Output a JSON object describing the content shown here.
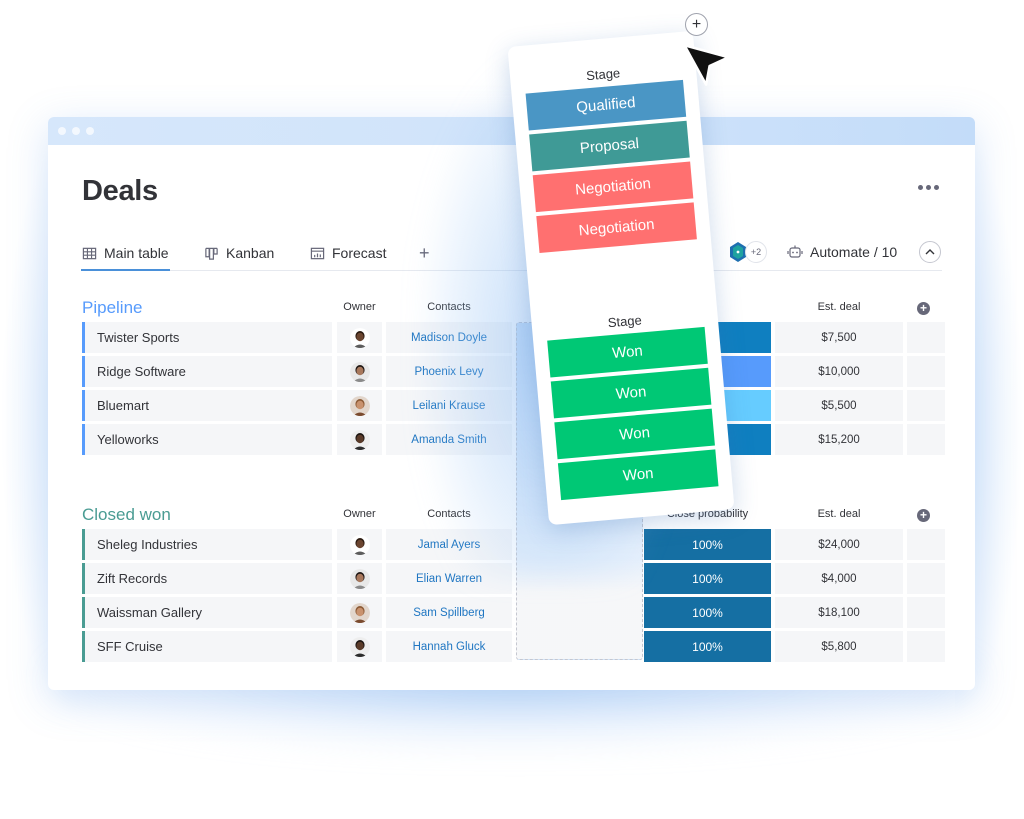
{
  "window": {
    "title": "Deals",
    "more_menu": "more-options"
  },
  "tabs": [
    {
      "label": "Main table",
      "icon": "table-icon",
      "active": true
    },
    {
      "label": "Kanban",
      "icon": "kanban-icon",
      "active": false
    },
    {
      "label": "Forecast",
      "icon": "forecast-icon",
      "active": false
    }
  ],
  "tab_add": "+",
  "toolbar": {
    "members_extra": "+2",
    "automate_label": "Automate / 10"
  },
  "colors": {
    "pipeline": "#579bfc",
    "closed_won": "#4a9c93",
    "qualified": "#4a96c5",
    "proposal": "#3f9a96",
    "negotiation": "#ff7070",
    "won": "#00c875",
    "prob_dark": "#1a6c9c"
  },
  "groups": [
    {
      "title": "Pipeline",
      "columns": {
        "owner": "Owner",
        "contacts": "Contacts",
        "probability": "",
        "deal": "Est. deal"
      },
      "rows": [
        {
          "name": "Twister Sports",
          "owner": "person-1",
          "contact": "Madison Doyle",
          "prob": "",
          "prob_color": "#0f7fc0",
          "deal": "$7,500"
        },
        {
          "name": "Ridge Software",
          "owner": "person-2",
          "contact": "Phoenix Levy",
          "prob": "",
          "prob_color": "#579bfc",
          "deal": "$10,000"
        },
        {
          "name": "Bluemart",
          "owner": "person-3",
          "contact": "Leilani Krause",
          "prob": "",
          "prob_color": "#66ccff",
          "deal": "$5,500"
        },
        {
          "name": "Yelloworks",
          "owner": "person-4",
          "contact": "Amanda Smith",
          "prob": "",
          "prob_color": "#0f7fc0",
          "deal": "$15,200"
        }
      ]
    },
    {
      "title": "Closed won",
      "columns": {
        "owner": "Owner",
        "contacts": "Contacts",
        "probability": "Close probability",
        "deal": "Est. deal"
      },
      "rows": [
        {
          "name": "Sheleg Industries",
          "owner": "person-1",
          "contact": "Jamal Ayers",
          "prob": "100%",
          "prob_color": "#156fa3",
          "deal": "$24,000"
        },
        {
          "name": "Zift Records",
          "owner": "person-2",
          "contact": "Elian Warren",
          "prob": "100%",
          "prob_color": "#156fa3",
          "deal": "$4,000"
        },
        {
          "name": "Waissman Gallery",
          "owner": "person-3",
          "contact": "Sam Spillberg",
          "prob": "100%",
          "prob_color": "#156fa3",
          "deal": "$18,100"
        },
        {
          "name": "SFF Cruise",
          "owner": "person-4",
          "contact": "Hannah Gluck",
          "prob": "100%",
          "prob_color": "#156fa3",
          "deal": "$5,800"
        }
      ]
    }
  ],
  "stage_card": {
    "pipeline_label": "Stage",
    "pipeline_stages": [
      "Qualified",
      "Proposal",
      "Negotiation",
      "Negotiation"
    ],
    "closed_label": "Stage",
    "closed_stages": [
      "Won",
      "Won",
      "Won",
      "Won"
    ]
  },
  "add_column": "+"
}
